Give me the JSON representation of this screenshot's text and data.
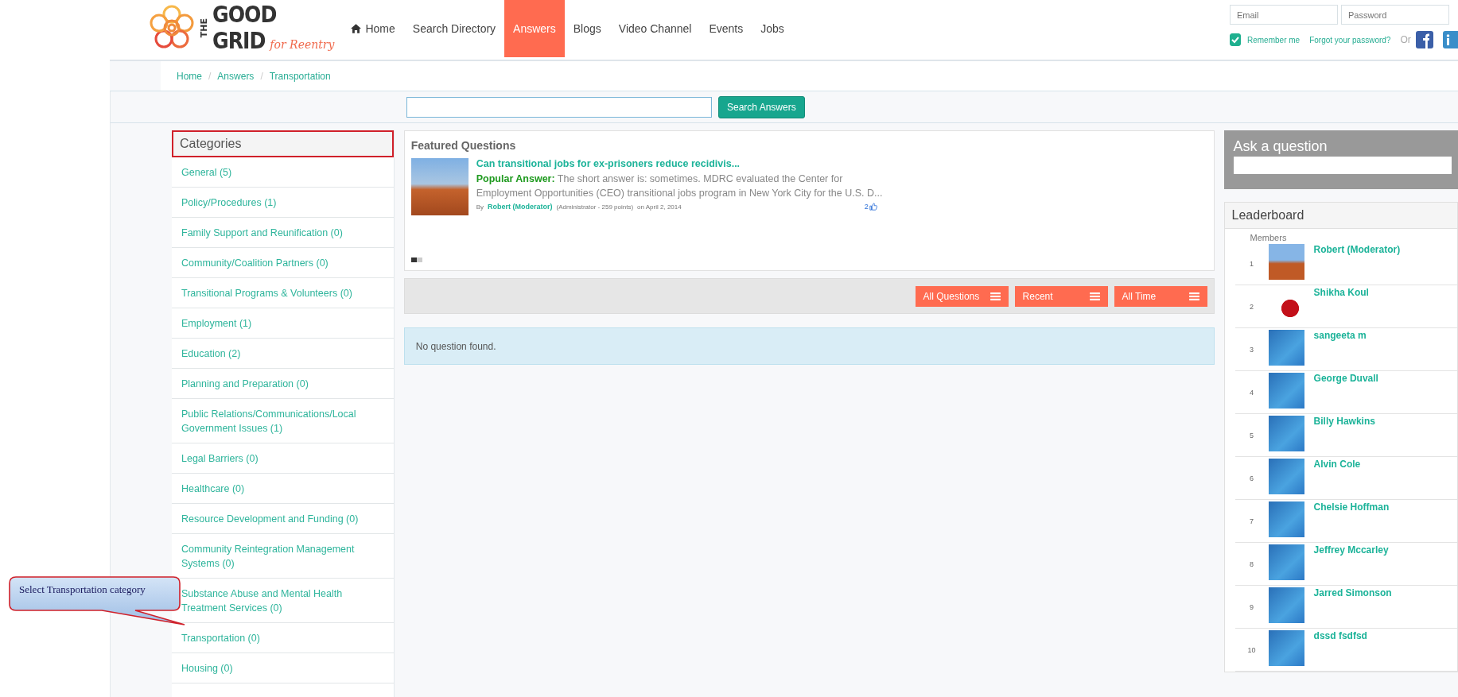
{
  "logo": {
    "word_top": "THE",
    "word_1": "GOOD",
    "word_2": "GRID",
    "tagline": "for Reentry"
  },
  "nav": [
    {
      "label": "Home",
      "kind": "home",
      "selected": false
    },
    {
      "label": "Search Directory",
      "selected": false
    },
    {
      "label": "Answers",
      "selected": true
    },
    {
      "label": "Blogs",
      "selected": false
    },
    {
      "label": "Video Channel",
      "selected": false
    },
    {
      "label": "Events",
      "selected": false
    },
    {
      "label": "Jobs",
      "selected": false
    }
  ],
  "login": {
    "email_placeholder": "Email",
    "password_placeholder": "Password",
    "remember_me": {
      "label": "Remember me",
      "checked": true
    },
    "forgot": "Forgot your password?",
    "or": "Or"
  },
  "breadcrumb": {
    "separator": "/",
    "items": [
      "Home",
      "Answers",
      "Transportation"
    ]
  },
  "search": {
    "button": "Search Answers"
  },
  "categories": {
    "title": "Categories",
    "highlighted": true,
    "items": [
      {
        "label": "General (5)"
      },
      {
        "label": "Policy/Procedures (1)"
      },
      {
        "label": "Family Support and Reunification (0)"
      },
      {
        "label": "Community/Coalition Partners (0)"
      },
      {
        "label": "Transitional Programs & Volunteers (0)"
      },
      {
        "label": "Employment (1)"
      },
      {
        "label": "Education (2)"
      },
      {
        "label": "Planning and Preparation (0)"
      },
      {
        "label": "Public Relations/Communications/Local Government Issues (1)"
      },
      {
        "label": "Legal Barriers (0)"
      },
      {
        "label": "Healthcare (0)"
      },
      {
        "label": "Resource Development and Funding (0)"
      },
      {
        "label": "Community Reintegration Management Systems (0)"
      },
      {
        "label": "Substance Abuse and Mental Health Treatment Services (0)"
      },
      {
        "label": "Transportation (0)"
      },
      {
        "label": "Housing (0)"
      }
    ]
  },
  "featured": {
    "title": "Featured Questions",
    "question": "Can transitional jobs for ex-prisoners reduce recidivis...",
    "answer_label": "Popular Answer:",
    "answer": "The short answer is: sometimes. MDRC evaluated the Center for Employment Opportunities (CEO) transitional jobs program in New York City for the U.S. D...",
    "by": "By",
    "author": "Robert (Moderator)",
    "role": "(Administrator - 259 points)",
    "date": "on April 2, 2014",
    "likes": "2",
    "pager": [
      {
        "selected": true
      },
      {
        "selected": false
      }
    ]
  },
  "filters": [
    "All Questions",
    "Recent",
    "All Time"
  ],
  "empty_message": "No question found.",
  "ask": {
    "title": "Ask a question"
  },
  "leaderboard": {
    "title": "Leaderboard",
    "column": "Members",
    "members": [
      {
        "rank": "1",
        "name": "Robert (Moderator)",
        "kind": "landscape"
      },
      {
        "rank": "2",
        "name": "Shikha Koul",
        "kind": "flower"
      },
      {
        "rank": "3",
        "name": "sangeeta m",
        "kind": "default"
      },
      {
        "rank": "4",
        "name": "George Duvall",
        "kind": "default"
      },
      {
        "rank": "5",
        "name": "Billy Hawkins",
        "kind": "default"
      },
      {
        "rank": "6",
        "name": "Alvin Cole",
        "kind": "default"
      },
      {
        "rank": "7",
        "name": "Chelsie Hoffman",
        "kind": "default"
      },
      {
        "rank": "8",
        "name": "Jeffrey Mccarley",
        "kind": "default"
      },
      {
        "rank": "9",
        "name": "Jarred Simonson",
        "kind": "default"
      },
      {
        "rank": "10",
        "name": "dssd fsdfsd",
        "kind": "default"
      }
    ]
  },
  "callout": {
    "text": "Select Transportation category"
  }
}
